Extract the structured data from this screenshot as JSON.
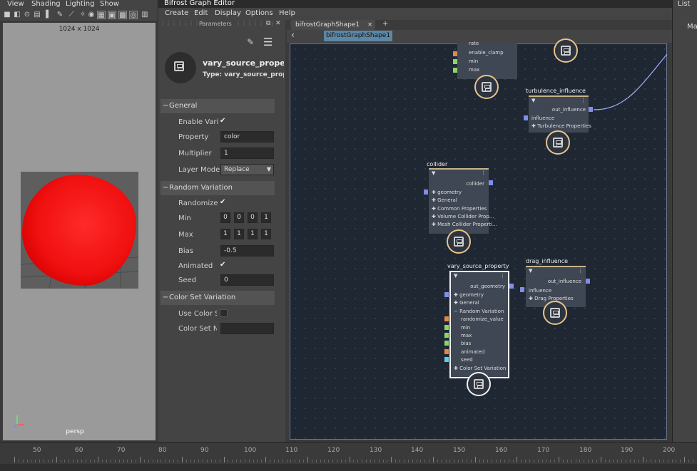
{
  "maya_menu": [
    "View",
    "Shading",
    "Lighting",
    "Show"
  ],
  "viewport": {
    "resolution": "1024 x 1024",
    "camera": "persp"
  },
  "bifrost": {
    "window_title": "Bifrost Graph Editor",
    "menu": [
      "Create",
      "Edit",
      "Display",
      "Options",
      "Help"
    ],
    "params_title": "Parameters",
    "node_name": "vary_source_propert",
    "node_type": "Type: vary_source_prope",
    "sections": {
      "general": {
        "title": "General",
        "enable_label": "Enable Varia",
        "enable_checked": true,
        "property_label": "Property",
        "property_value": "color",
        "multiplier_label": "Multiplier",
        "multiplier_value": "1",
        "layer_mode_label": "Layer Mode",
        "layer_mode_value": "Replace"
      },
      "random_variation": {
        "title": "Random Variation",
        "randomize_label": "Randomize",
        "randomize_checked": true,
        "min_label": "Min",
        "min_values": [
          "0",
          "0",
          "0",
          "1"
        ],
        "max_label": "Max",
        "max_values": [
          "1",
          "1",
          "1",
          "1"
        ],
        "bias_label": "Bias",
        "bias_value": "-0.5",
        "animated_label": "Animated",
        "animated_checked": true,
        "seed_label": "Seed",
        "seed_value": "0"
      },
      "color_set": {
        "title": "Color Set Variation",
        "use_label": "Use Color Se",
        "name_label": "Color Set Na"
      }
    },
    "tabs": {
      "active": "bifrostGraphShape1",
      "add": "+"
    },
    "breadcrumb": "bifrostGraphShape1"
  },
  "graph": {
    "top_node_ports": [
      "rate",
      "enable_clamp",
      "min",
      "max"
    ],
    "turbulence": {
      "title": "turbulence_influence",
      "out": "out_influence",
      "in1": "influence",
      "in2": "Turbulence Properties"
    },
    "collider": {
      "title": "collider",
      "out": "collider",
      "ports": [
        "geometry",
        "General",
        "Common Properties",
        "Volume Collider Prop...",
        "Mesh Collider Properti..."
      ]
    },
    "vary_source": {
      "title": "vary_source_property",
      "out": "out_geometry",
      "ports": [
        "geometry",
        "General",
        "Random Variation"
      ],
      "subports": [
        "randomize_value",
        "min",
        "max",
        "bias",
        "animated",
        "seed"
      ],
      "last": "Color Set Variation"
    },
    "drag": {
      "title": "drag_influence",
      "out": "out_influence",
      "in1": "influence",
      "in2": "Drag Properties"
    }
  },
  "timeline": {
    "labels": [
      "50",
      "60",
      "70",
      "80",
      "90",
      "100",
      "110",
      "120",
      "130",
      "140",
      "150",
      "160",
      "170",
      "180",
      "190",
      "200"
    ]
  },
  "right_panel": {
    "list": "List",
    "mat": "Ma"
  },
  "colors": {
    "graph_bg": "#1f2733",
    "node_bg": "#3f4754",
    "badge_ring": "#e8c48a",
    "pin_orange": "#e08a4a",
    "pin_green": "#8fd46a",
    "pin_blue": "#7f8ee8",
    "pin_cyan": "#5ecfe0",
    "particle_red": "#ff2a2a"
  }
}
